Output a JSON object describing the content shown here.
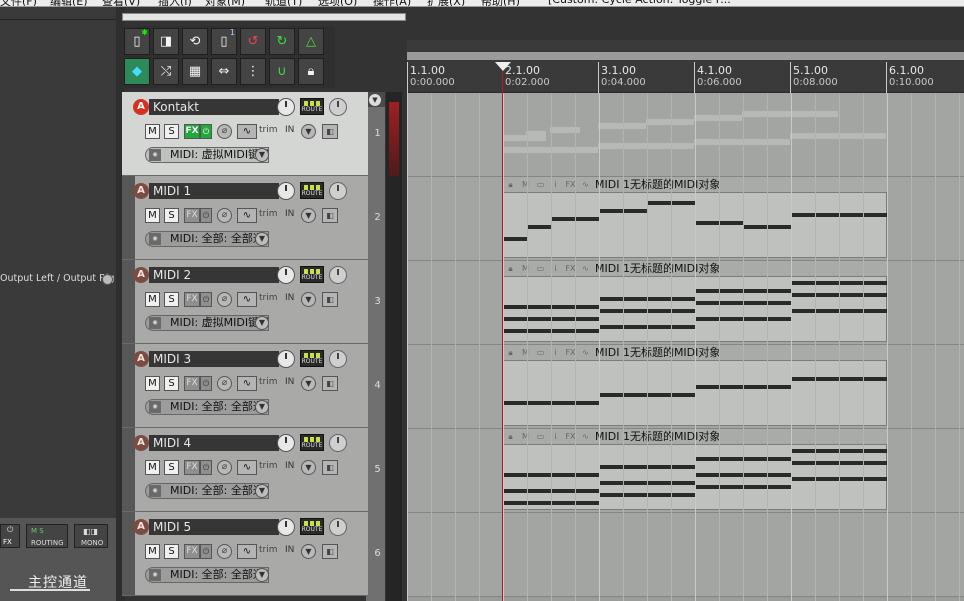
{
  "menubar": {
    "items": [
      "文件(F)",
      "编辑(E)",
      "查看(V)",
      "插入(I)",
      "对象(M)",
      "轨道(T)",
      "选项(O)",
      "操作(A)",
      "扩展(X)",
      "帮助(H)",
      "[Custom: Cycle Action: Toggle F..."
    ]
  },
  "left_panel": {
    "output_label": "Output Left / Output Rig"
  },
  "master": {
    "fx_label": "FX",
    "routing_label": "ROUTING",
    "mono_label": "MONO",
    "title": "主控通道"
  },
  "toolbar": {
    "badge": "1"
  },
  "tracks": [
    {
      "index": "1",
      "name": "Kontakt",
      "input": "MIDI: 虚拟MIDI键盘",
      "selected": true
    },
    {
      "index": "2",
      "name": "MIDI 1",
      "input": "MIDI: 全部: 全部通道",
      "selected": false
    },
    {
      "index": "3",
      "name": "MIDI 2",
      "input": "MIDI: 虚拟MIDI键盘",
      "selected": false
    },
    {
      "index": "4",
      "name": "MIDI 3",
      "input": "MIDI: 全部: 全部通道",
      "selected": false
    },
    {
      "index": "5",
      "name": "MIDI 4",
      "input": "MIDI: 全部: 全部通道",
      "selected": false
    },
    {
      "index": "6",
      "name": "MIDI 5",
      "input": "MIDI: 全部: 全部通道",
      "selected": false
    }
  ],
  "track_controls": {
    "mute": "M",
    "solo": "S",
    "fx": "FX",
    "trim": "trim",
    "in": "IN",
    "route": "ROUTE"
  },
  "ruler": [
    {
      "bar": "1.1.00",
      "time": "0:00.000"
    },
    {
      "bar": "2.1.00",
      "time": "0:02.000"
    },
    {
      "bar": "3.1.00",
      "time": "0:04.000"
    },
    {
      "bar": "4.1.00",
      "time": "0:06.000"
    },
    {
      "bar": "5.1.00",
      "time": "0:08.000"
    },
    {
      "bar": "6.1.00",
      "time": "0:10.000"
    }
  ],
  "midi_item_name": "MIDI 1无标题的MIDI对象"
}
